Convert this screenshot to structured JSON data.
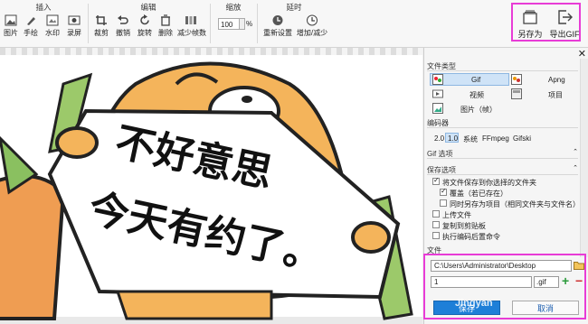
{
  "ribbon": {
    "insert": {
      "title": "插入",
      "items": [
        "图片",
        "手绘",
        "水印",
        "录屏"
      ]
    },
    "edit": {
      "title": "编辑",
      "items": [
        "裁剪",
        "撤销",
        "旋转",
        "删除",
        "减少帧数"
      ]
    },
    "zoom": {
      "title": "缩放",
      "value": "100",
      "unit": "%"
    },
    "delay": {
      "title": "延时",
      "items": [
        "重新设置",
        "增加/减少"
      ]
    },
    "save_as": "另存为",
    "export_gif": "导出GIF"
  },
  "canvas": {
    "line1": "不好意思",
    "line2": "今天有约了。"
  },
  "panel": {
    "file_type": {
      "title": "文件类型",
      "types": [
        "Gif",
        "Apng",
        "视频",
        "项目",
        "图片（帧）"
      ],
      "selected": "Gif"
    },
    "encoder": {
      "title": "编码器",
      "options": [
        "2.0",
        "1.0",
        "系统",
        "FFmpeg",
        "Gifski"
      ],
      "selected": "1.0"
    },
    "gif_options": {
      "title": "Gif 选项"
    },
    "save_options": {
      "title": "保存选项",
      "items": [
        {
          "label": "将文件保存到你选择的文件夹",
          "checked": true
        },
        {
          "label": "覆盖（若已存在）",
          "checked": true
        },
        {
          "label": "同时另存为项目（相同文件夹与文件名）",
          "checked": false
        },
        {
          "label": "上传文件",
          "checked": false
        },
        {
          "label": "复制到剪贴板",
          "checked": false
        },
        {
          "label": "执行编码后置命令",
          "checked": false
        }
      ]
    },
    "file": {
      "title": "文件",
      "path": "C:\\Users\\Administrator\\Desktop",
      "name": "1",
      "ext": ".gif"
    },
    "save_button": "保存",
    "cancel_button": "取消"
  },
  "watermark": "Jingyan",
  "colors": {
    "accent": "#1e7fd8",
    "highlight": "#e83cd6"
  }
}
